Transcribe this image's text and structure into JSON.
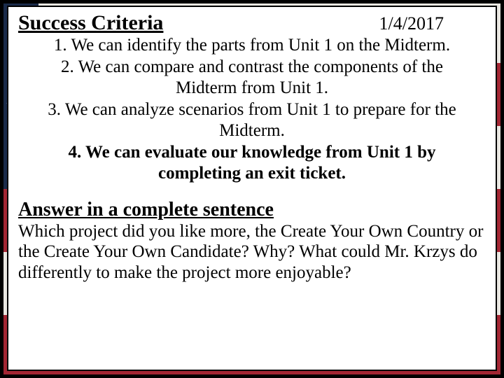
{
  "header": {
    "title": "Success Criteria",
    "date": "1/4/2017"
  },
  "criteria": {
    "item1": "1. We can identify the parts from Unit 1 on the Midterm.",
    "item2a": "2. We can compare and contrast the components of the",
    "item2b": "Midterm from Unit 1.",
    "item3a": "3. We can analyze scenarios from Unit 1 to prepare for the",
    "item3b": "Midterm.",
    "item4a": "4. We can evaluate our knowledge from Unit 1 by",
    "item4b": "completing an exit ticket."
  },
  "answer": {
    "title": "Answer in a complete sentence",
    "body": "Which project did you like more, the Create Your Own Country or the Create Your Own Candidate? Why? What could Mr. Krzys do differently to make the project more enjoyable?"
  }
}
